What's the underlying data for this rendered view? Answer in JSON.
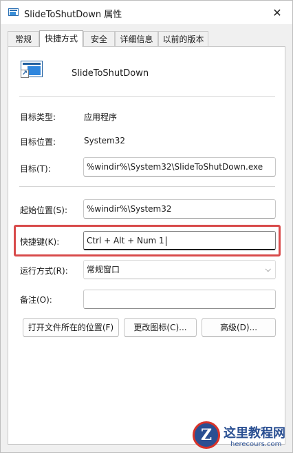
{
  "window": {
    "title": "SlideToShutDown 属性",
    "close_glyph": "✕"
  },
  "tabs": [
    {
      "label": "常规",
      "active": false
    },
    {
      "label": "快捷方式",
      "active": true
    },
    {
      "label": "安全",
      "active": false
    },
    {
      "label": "详细信息",
      "active": false
    },
    {
      "label": "以前的版本",
      "active": false
    }
  ],
  "shortcut": {
    "app_name": "SlideToShutDown",
    "app_icon": "shortcut-app-icon",
    "target_type": {
      "label": "目标类型:",
      "value": "应用程序"
    },
    "target_location": {
      "label": "目标位置:",
      "value": "System32"
    },
    "target": {
      "label": "目标(T):",
      "value": "%windir%\\System32\\SlideToShutDown.exe"
    },
    "start_in": {
      "label": "起始位置(S):",
      "value": "%windir%\\System32"
    },
    "shortcut_key": {
      "label": "快捷键(K):",
      "value": "Ctrl + Alt + Num 1"
    },
    "run": {
      "label": "运行方式(R):",
      "value": "常规窗口"
    },
    "comment": {
      "label": "备注(O):",
      "value": ""
    }
  },
  "buttons": {
    "open_location": "打开文件所在的位置(F)",
    "change_icon": "更改图标(C)...",
    "advanced": "高级(D)..."
  },
  "colors": {
    "highlight": "#d84a4a",
    "watermark": "#2a4f92"
  },
  "watermark": {
    "logo": "Z",
    "title": "这里教程网",
    "subtitle": "herecours.com"
  }
}
